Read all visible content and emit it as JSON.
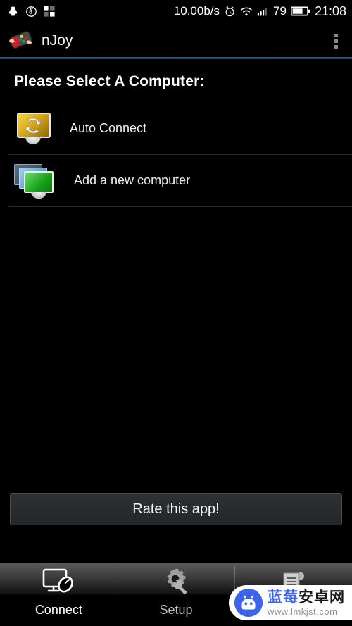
{
  "statusbar": {
    "left_icons": [
      "qq-penguin-icon",
      "netease-music-icon",
      "grid-apps-icon"
    ],
    "network_speed": "10.00b/s",
    "alarm_icon": "alarm-clock-icon",
    "wifi_icon": "wifi-icon",
    "signal_icon": "cellular-signal-icon",
    "battery_percent": "79",
    "battery_icon": "battery-icon",
    "time": "21:08"
  },
  "actionbar": {
    "app_icon": "njoy-gamepad-icon",
    "title": "nJoy",
    "overflow_label": "overflow-menu",
    "accent_color": "#5b92c4"
  },
  "main": {
    "page_title": "Please Select A Computer:",
    "items": [
      {
        "label": "Auto Connect",
        "icon": "auto-connect-monitor-icon"
      },
      {
        "label": "Add a new computer",
        "icon": "add-computer-stack-icon"
      }
    ]
  },
  "rate": {
    "label": "Rate this app!"
  },
  "tabbar": {
    "tabs": [
      {
        "label": "Connect",
        "icon": "monitor-mouse-icon",
        "active": true
      },
      {
        "label": "Setup",
        "icon": "gear-wrench-icon",
        "active": false
      },
      {
        "label": "",
        "icon": "scroll-log-icon",
        "active": false
      }
    ]
  },
  "watermark": {
    "logo": "android-robot-icon",
    "name_part1": "蓝莓",
    "name_part2": "安卓网",
    "url": "www.lmkjst.com"
  }
}
